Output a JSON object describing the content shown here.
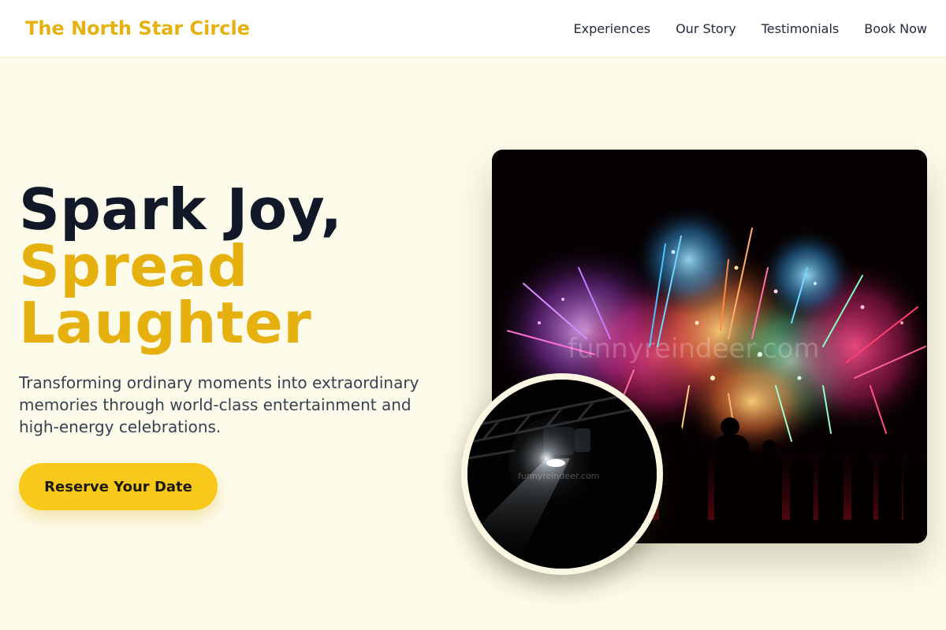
{
  "header": {
    "brand": "The North Star Circle",
    "nav": [
      {
        "label": "Experiences"
      },
      {
        "label": "Our Story"
      },
      {
        "label": "Testimonials"
      },
      {
        "label": "Book Now"
      }
    ]
  },
  "hero": {
    "title_line1": "Spark Joy,",
    "title_line2": "Spread",
    "title_line3": "Laughter",
    "subtitle": "Transforming ordinary moments into extraordinary memories through world-class entertainment and high-energy celebrations.",
    "cta_label": "Reserve Your Date"
  },
  "images": {
    "main_watermark": "funnyreindeer.com",
    "inset_watermark": "funnyreindeer.com"
  },
  "colors": {
    "accent": "#e6b10f",
    "button": "#f8c91b",
    "background": "#fdfbea",
    "heading": "#111827"
  },
  "icons": {
    "main_image": "fireworks-crowd-photo",
    "inset_image": "stage-spotlight-photo"
  }
}
